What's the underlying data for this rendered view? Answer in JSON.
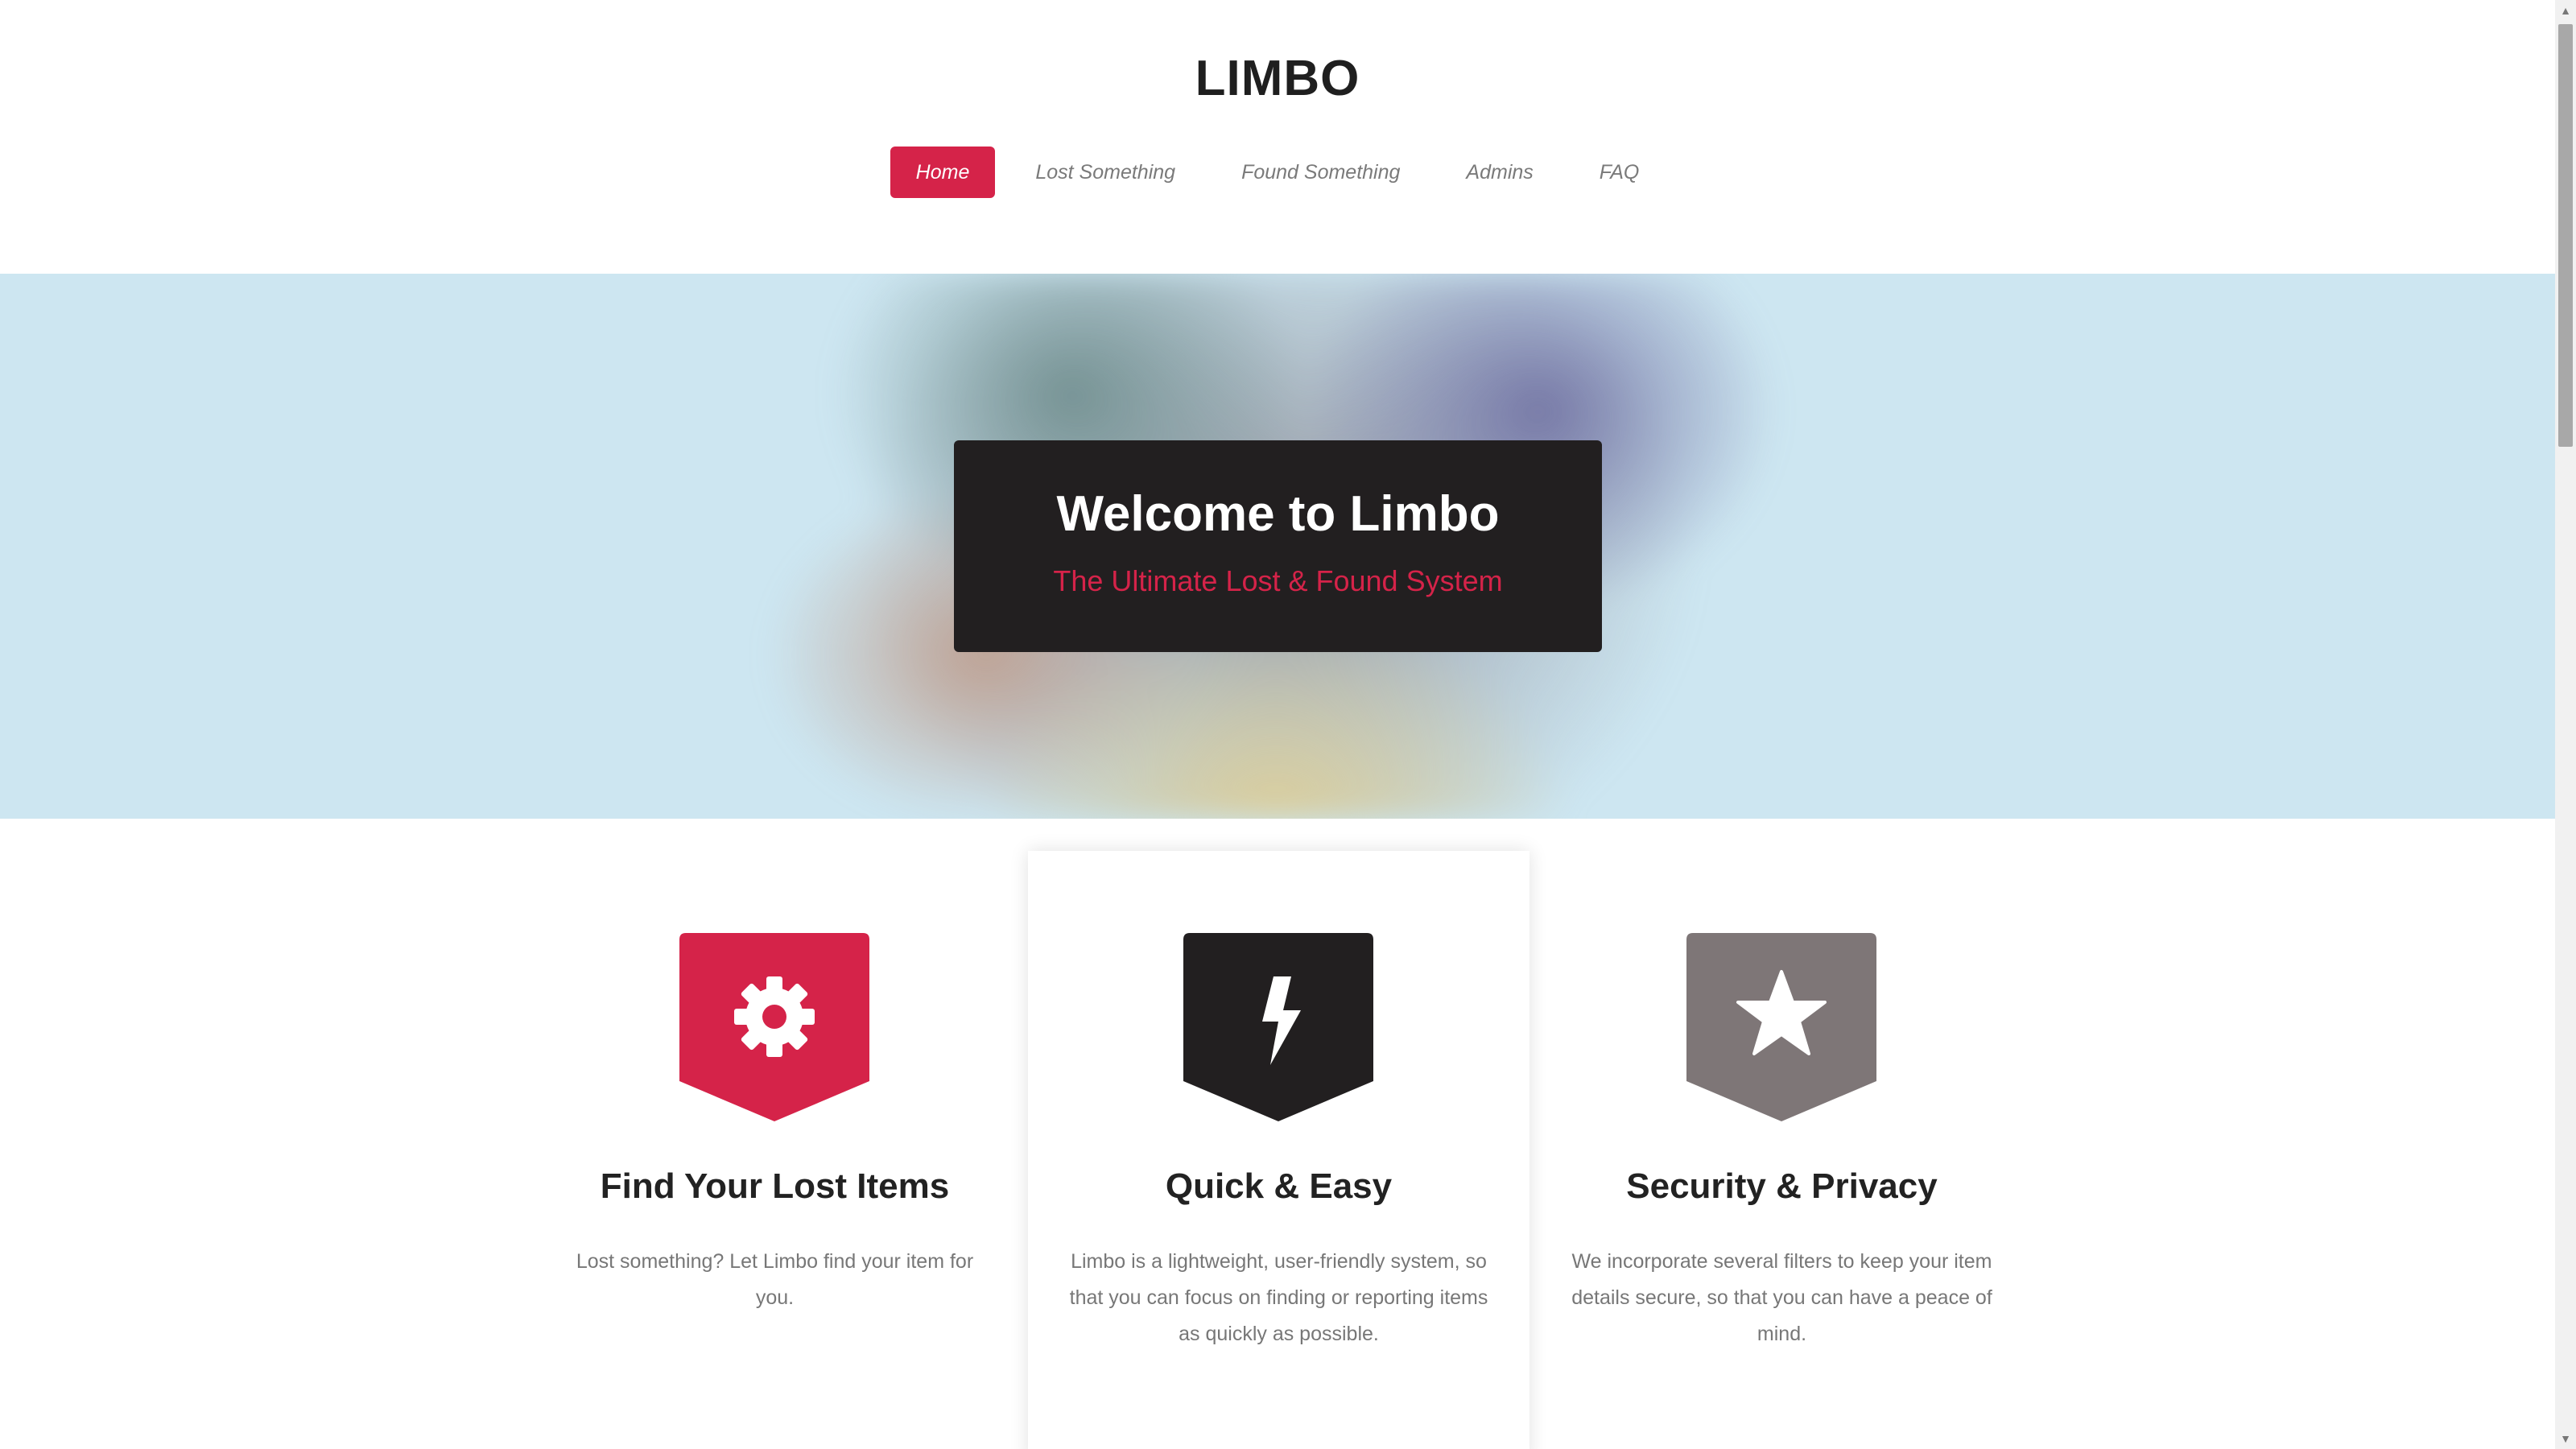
{
  "header": {
    "site_title": "LIMBO",
    "nav": [
      {
        "label": "Home",
        "active": true
      },
      {
        "label": "Lost Something",
        "active": false
      },
      {
        "label": "Found Something",
        "active": false
      },
      {
        "label": "Admins",
        "active": false
      },
      {
        "label": "FAQ",
        "active": false
      }
    ]
  },
  "hero": {
    "title": "Welcome to Limbo",
    "subtitle": "The Ultimate Lost & Found System"
  },
  "features": [
    {
      "icon": "gear-icon",
      "badge_color": "#d52349",
      "title": "Find Your Lost Items",
      "text": "Lost something? Let Limbo find your item for you."
    },
    {
      "icon": "lightning-icon",
      "badge_color": "#221f20",
      "title": "Quick & Easy",
      "text": "Limbo is a lightweight, user-friendly system, so that you can focus on finding or reporting items as quickly as possible."
    },
    {
      "icon": "star-icon",
      "badge_color": "#7e7677",
      "title": "Security & Privacy",
      "text": "We incorporate several filters to keep your item details secure, so that you can have a peace of mind."
    }
  ],
  "colors": {
    "accent": "#d52349",
    "dark": "#221f20",
    "hero_bg": "#cde6f1"
  }
}
